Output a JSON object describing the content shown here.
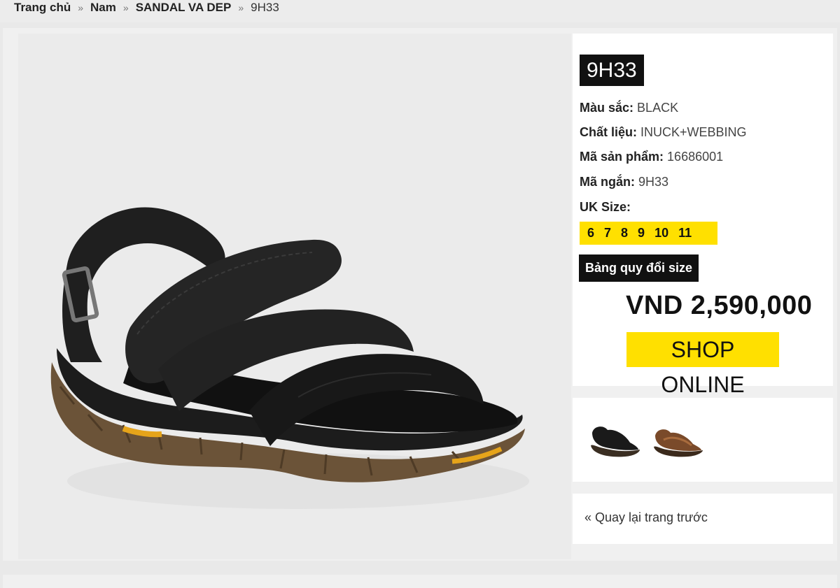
{
  "breadcrumb": {
    "home": "Trang chủ",
    "sep1": "»",
    "category": "Nam",
    "sep2": "»",
    "subcategory": "SANDAL VA DEP",
    "sep3": "»",
    "current": "9H33"
  },
  "product": {
    "name": "9H33",
    "color_label": "Màu sắc:",
    "color_value": "BLACK",
    "material_label": "Chất liệu:",
    "material_value": "INUCK+WEBBING",
    "sku_label": "Mã sản phẩm:",
    "sku_value": "16686001",
    "short_label": "Mã ngắn:",
    "short_value": "9H33",
    "size_label": "UK Size:",
    "sizes": [
      "6",
      "7",
      "8",
      "9",
      "10",
      "11"
    ],
    "size_chart_label": "Bảng quy đổi size",
    "price": "VND 2,590,000",
    "shop_button": "SHOP ONLINE"
  },
  "thumbnails": [
    {
      "name": "thumbnail-black-sandal",
      "color": "#1a1a1a"
    },
    {
      "name": "thumbnail-brown-sandal",
      "color": "#7a4a2a"
    }
  ],
  "back_link": "« Quay lại trang trước",
  "colors": {
    "accent": "#ffe000",
    "dark": "#111111",
    "background": "#e9e9e9"
  }
}
